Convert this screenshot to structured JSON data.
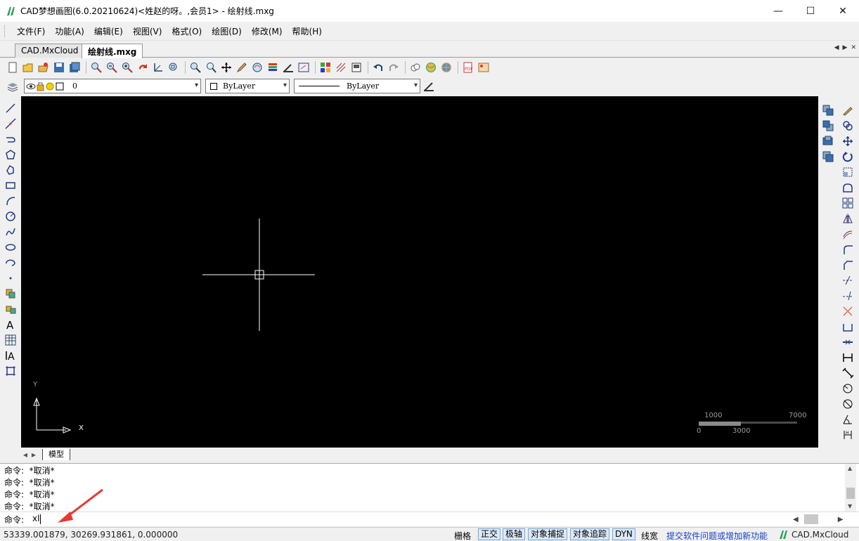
{
  "window": {
    "title": "CAD梦想画图(6.0.20210624)<姓赵的呀。,会员1> - 绘射线.mxg",
    "controls": {
      "minimize": "—",
      "maximize": "☐",
      "close": "✕"
    }
  },
  "menu": [
    "文件(F)",
    "功能(A)",
    "编辑(E)",
    "视图(V)",
    "格式(O)",
    "绘图(D)",
    "修改(M)",
    "帮助(H)"
  ],
  "tabs": [
    {
      "label": "CAD.MxCloud",
      "active": false
    },
    {
      "label": "绘射线.mxg",
      "active": true
    }
  ],
  "tab_nav": {
    "prev": "◀",
    "next": "▶",
    "close": "✕"
  },
  "layer_toolbar": {
    "layer_value": "0",
    "color_value": "ByLayer",
    "linetype_value": "ByLayer"
  },
  "canvas": {
    "ucs_y_label": "Y",
    "ucs_x_label": "X",
    "scale_bar": {
      "top_left": "1000",
      "top_right": "7000",
      "bottom_left": "0",
      "bottom_mid": "3000"
    }
  },
  "layout_tabs": {
    "model": "模型"
  },
  "command": {
    "history": [
      "命令:  *取消*",
      "命令:  *取消*",
      "命令:  *取消*",
      "命令:  *取消*"
    ],
    "prompt": "命令:",
    "input_value": "xl"
  },
  "status": {
    "coordinates": "53339.001879,  30269.931861,  0.000000",
    "grid_label": "栅格",
    "ortho_label": "正交",
    "polar_label": "极轴",
    "osnap_label": "对象捕捉",
    "otrack_label": "对象追踪",
    "dyn_label": "DYN",
    "lineweight_label": "线宽",
    "feedback_link": "提交软件问题或增加新功能",
    "brand": "CAD.MxCloud"
  },
  "colors": {
    "canvas_bg": "#000000",
    "accent": "#1a3fc9",
    "brand_green": "#2e9d5c",
    "annotation_arrow": "#e53935"
  }
}
